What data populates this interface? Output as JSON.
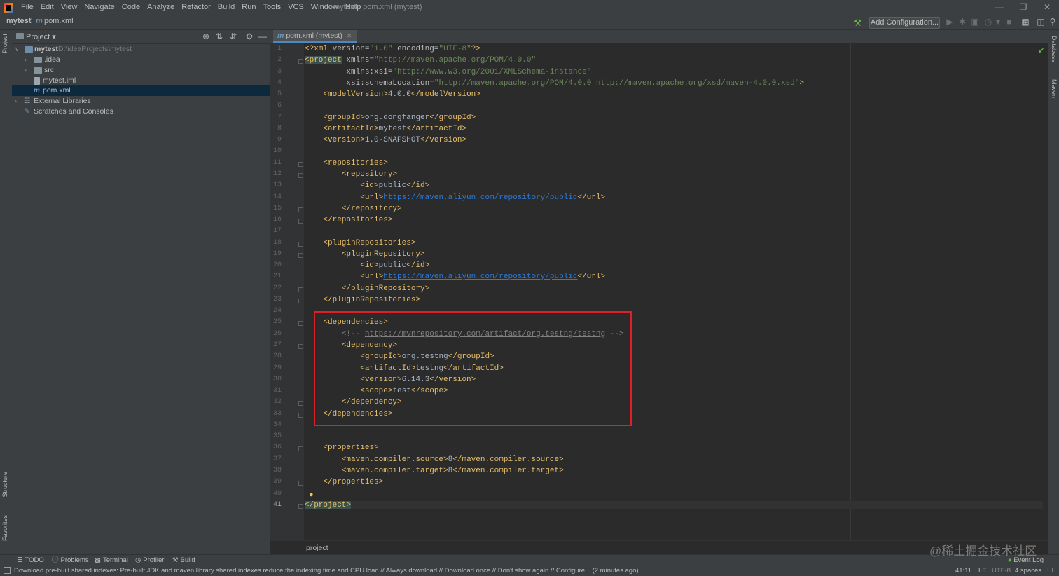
{
  "menu": {
    "items": [
      "File",
      "Edit",
      "View",
      "Navigate",
      "Code",
      "Analyze",
      "Refactor",
      "Build",
      "Run",
      "Tools",
      "VCS",
      "Window",
      "Help"
    ],
    "window_title": "mytest - pom.xml (mytest)"
  },
  "navbar": {
    "project": "mytest",
    "separator": "/",
    "file_icon": "m",
    "file": "pom.xml",
    "add_configuration": "Add Configuration..."
  },
  "project_panel": {
    "title": "Project",
    "tree": [
      {
        "label": "mytest",
        "path": "D:\\ideaProjects\\mytest",
        "icon": "folder-icon",
        "arrow": "v"
      },
      {
        "label": ".idea",
        "icon": "folder-icon",
        "arrow": ">"
      },
      {
        "label": "src",
        "icon": "folder-icon",
        "arrow": ">"
      },
      {
        "label": "mytest.iml",
        "icon": "iml-file-icon"
      },
      {
        "label": "pom.xml",
        "icon": "maven-file-icon",
        "selected": true
      },
      {
        "label": "External Libraries",
        "icon": "library-icon",
        "arrow": ">"
      },
      {
        "label": "Scratches and Consoles",
        "icon": "scratches-icon"
      }
    ]
  },
  "editor": {
    "tab_label": "pom.xml (mytest)",
    "tab_icon": "m",
    "lines": [
      "<?xml version=\"1.0\" encoding=\"UTF-8\"?>",
      "<project xmlns=\"http://maven.apache.org/POM/4.0.0\"",
      "         xmlns:xsi=\"http://www.w3.org/2001/XMLSchema-instance\"",
      "         xsi:schemaLocation=\"http://maven.apache.org/POM/4.0.0 http://maven.apache.org/xsd/maven-4.0.0.xsd\">",
      "    <modelVersion>4.0.0</modelVersion>",
      "",
      "    <groupId>org.dongfanger</groupId>",
      "    <artifactId>mytest</artifactId>",
      "    <version>1.0-SNAPSHOT</version>",
      "",
      "    <repositories>",
      "        <repository>",
      "            <id>public</id>",
      "            <url>https://maven.aliyun.com/repository/public</url>",
      "        </repository>",
      "    </repositories>",
      "",
      "    <pluginRepositories>",
      "        <pluginRepository>",
      "            <id>public</id>",
      "            <url>https://maven.aliyun.com/repository/public</url>",
      "        </pluginRepository>",
      "    </pluginRepositories>",
      "",
      "    <dependencies>",
      "        <!-- https://mvnrepository.com/artifact/org.testng/testng -->",
      "        <dependency>",
      "            <groupId>org.testng</groupId>",
      "            <artifactId>testng</artifactId>",
      "            <version>6.14.3</version>",
      "            <scope>test</scope>",
      "        </dependency>",
      "    </dependencies>",
      "",
      "",
      "    <properties>",
      "        <maven.compiler.source>8</maven.compiler.source>",
      "        <maven.compiler.target>8</maven.compiler.target>",
      "    </properties>",
      "",
      "</project>"
    ],
    "breadcrumb": "project"
  },
  "left_strip": {
    "project": "Project",
    "structure": "Structure",
    "favorites": "Favorites"
  },
  "right_strip": {
    "database": "Database",
    "maven": "Maven"
  },
  "bottom_tools": [
    {
      "label": "TODO",
      "icon": "list-icon"
    },
    {
      "label": "Problems",
      "icon": "problems-icon"
    },
    {
      "label": "Terminal",
      "icon": "terminal-icon"
    },
    {
      "label": "Profiler",
      "icon": "profiler-icon"
    },
    {
      "label": "Build",
      "icon": "hammer-icon"
    }
  ],
  "event_log": "Event Log",
  "status": {
    "message": "Download pre-built shared indexes: Pre-built JDK and maven library shared indexes reduce the indexing time and CPU load // Always download // Download once // Don't show again // Configure... (2 minutes ago)",
    "position": "41:11",
    "line_sep": "LF",
    "encoding": "UTF-8",
    "indent": "4 spaces"
  },
  "watermark": "@稀土掘金技术社区"
}
